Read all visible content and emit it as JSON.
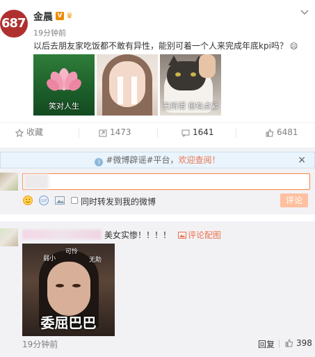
{
  "post": {
    "avatar_text": "687",
    "author": "金晨",
    "verified_badge": "V",
    "time": "19分钟前",
    "text": "以后去朋友家吃饭都不敢有异性，能别可着一个人来完成年底kpi吗？",
    "text_icon": "sad-face-icon",
    "images": [
      {
        "caption": "笑对人生",
        "subject": "lotus"
      },
      {
        "caption": "",
        "subject": "woman-with-tape"
      },
      {
        "caption": "无所谓 但有点紧",
        "subject": "cat"
      }
    ]
  },
  "actions": {
    "favorite": "收藏",
    "repost_count": "1473",
    "comment_count": "1641",
    "like_count": "6481"
  },
  "notice": {
    "text_prefix": "#微博辟谣#平台，",
    "text_highlight": "欢迎查阅！",
    "close": "×"
  },
  "comment_box": {
    "forward_label": "同时转发到我的微博",
    "submit": "评论"
  },
  "comment": {
    "text": "美女实惨！！！！",
    "pic_link": "评论配图",
    "image_words": {
      "w1": "弱小",
      "w2": "可怜",
      "w3": "无助",
      "big": "委屈巴巴"
    },
    "time": "19分钟前",
    "reply": "回复",
    "like_count": "398"
  },
  "colors": {
    "accent": "#eb7350",
    "input_border": "#ff8140",
    "submit_bg": "#ffc09f",
    "notice_bg": "#eaf4fc"
  }
}
